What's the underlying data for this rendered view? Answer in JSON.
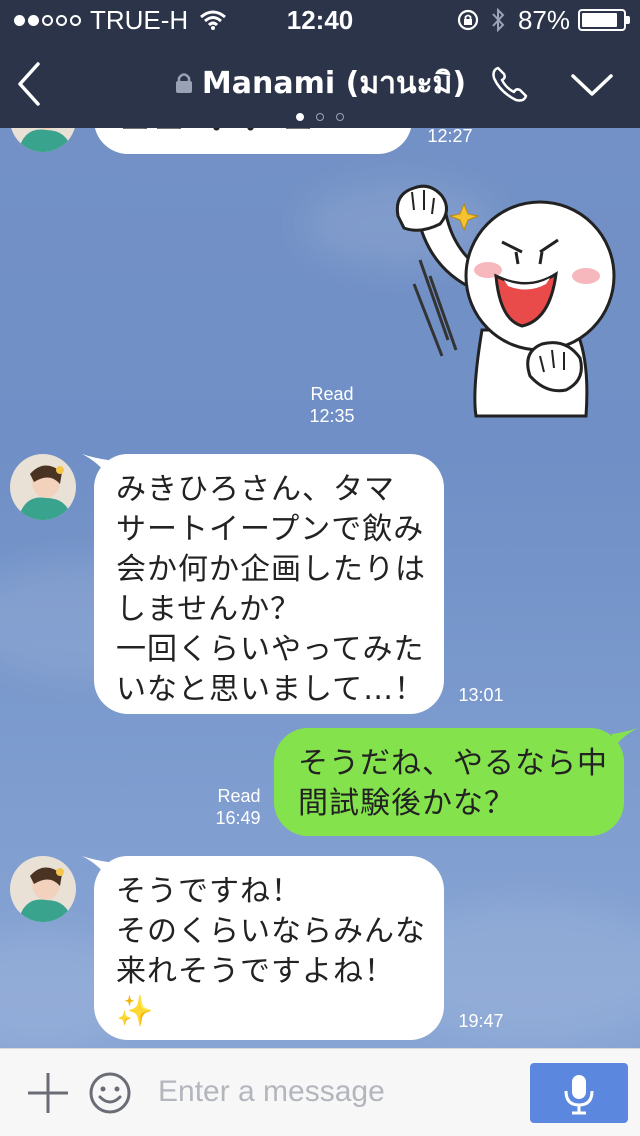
{
  "status": {
    "carrier": "TRUE-H",
    "time": "12:40",
    "battery": "87%",
    "battery_level": 0.87,
    "signal_bars": 2
  },
  "header": {
    "title": "Manami (มานะมิ)",
    "page_count": 3,
    "active_page": 0
  },
  "messages": [
    {
      "type": "text",
      "side": "left",
      "lines": [],
      "time": "12:27"
    },
    {
      "type": "sticker",
      "side": "right",
      "read": "Read",
      "time": "12:35",
      "sticker": "fist-pump-character"
    },
    {
      "type": "text",
      "side": "left",
      "lines": [
        "みきひろさん、タマ",
        "サートイープンで飲み",
        "会か何か企画したりは",
        "しませんか？",
        "一回くらいやってみた",
        "いなと思いまして…！"
      ],
      "time": "13:01"
    },
    {
      "type": "text",
      "side": "right",
      "read": "Read",
      "lines": [
        "そうだね、やるなら中",
        "間試験後かな？"
      ],
      "time": "16:49"
    },
    {
      "type": "text",
      "side": "left",
      "lines": [
        "そうですね！",
        "そのくらいならみんな",
        "来れそうですよね！",
        "✨"
      ],
      "time": "19:47"
    }
  ],
  "input": {
    "placeholder": "Enter a message"
  },
  "colors": {
    "header_bg": "#2b3449",
    "sent_bubble": "#84e34d",
    "received_bubble": "#ffffff",
    "mic_button": "#5b88de"
  },
  "icons": {
    "back": "back-chevron-icon",
    "lock": "lock-icon",
    "call": "phone-icon",
    "menu": "chevron-down-icon",
    "plus": "plus-icon",
    "emoji": "smiley-icon",
    "mic": "microphone-icon"
  }
}
